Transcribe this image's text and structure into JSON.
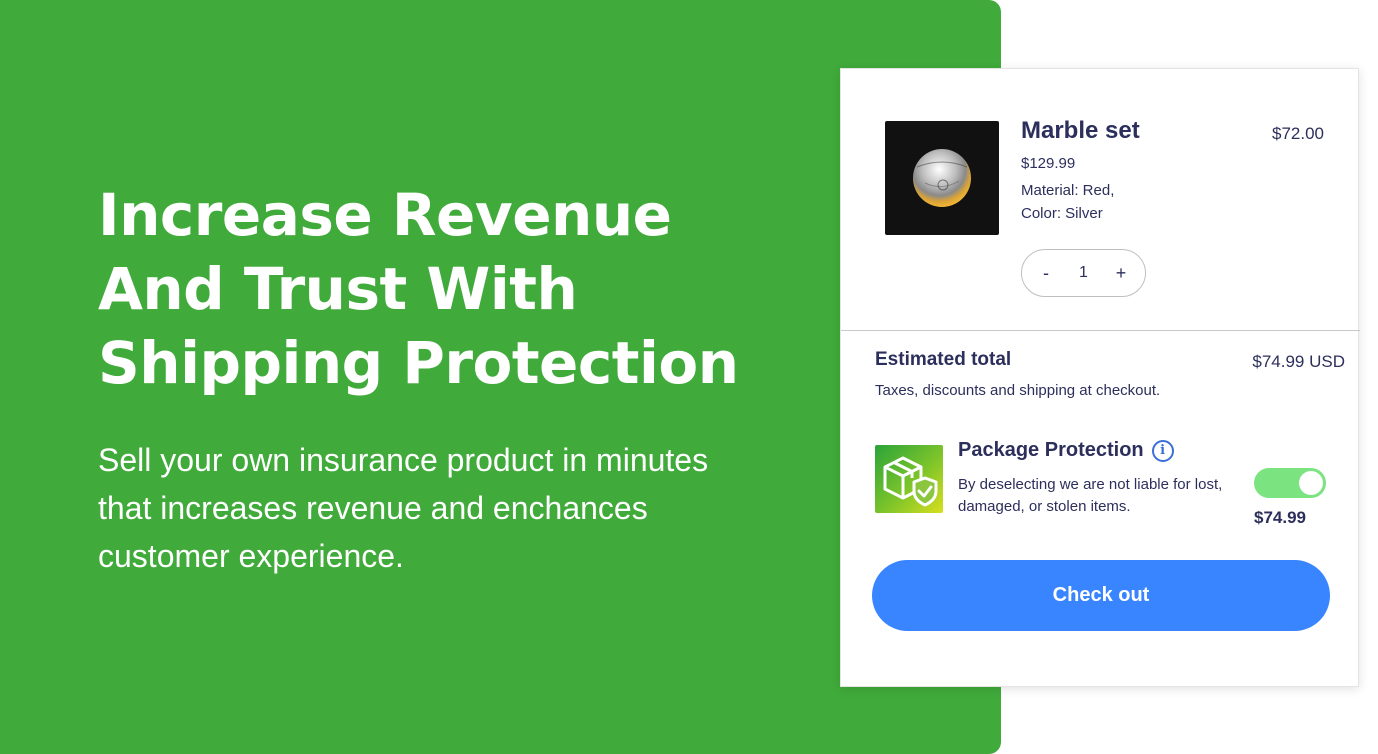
{
  "hero": {
    "headline_lines": [
      "Increase Revenue",
      "And Trust With",
      "Shipping Protection"
    ],
    "subtext_lines": [
      "Sell your own insurance product in minutes",
      "that increases revenue and enchances",
      "customer experience."
    ],
    "background_color": "#40ab3b"
  },
  "cart": {
    "product": {
      "name": "Marble set",
      "compare_price": "$129.99",
      "material": "Material: Red,",
      "color": "Color: Silver",
      "price": "$72.00",
      "image_icon": "marble-ball-image"
    },
    "quantity": {
      "decrement": "-",
      "value": "1",
      "increment": "+"
    },
    "estimated_total": {
      "label": "Estimated total",
      "value": "$74.99 USD",
      "note": "Taxes, discounts and shipping at checkout."
    },
    "protection": {
      "title": "Package Protection",
      "info_icon": "i",
      "description": "By deselecting we are not liable for lost, damaged, or stolen items.",
      "price": "$74.99",
      "enabled": true,
      "toggle_color": "#7ce381"
    },
    "checkout_label": "Check out",
    "checkout_color": "#3885ff"
  }
}
